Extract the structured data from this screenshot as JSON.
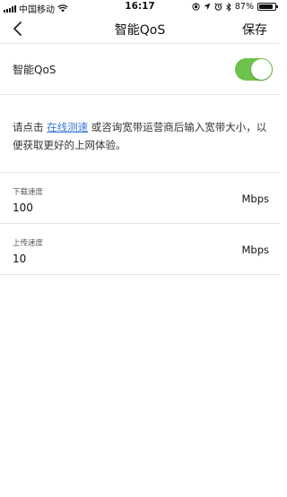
{
  "status_bar": {
    "carrier": "中国移动",
    "time": "16:17",
    "battery_percent": "87%",
    "battery_level": 0.87,
    "icons": [
      "signal-icon",
      "wifi-icon",
      "orientation-lock-icon",
      "location-icon",
      "alarm-icon",
      "bluetooth-icon",
      "battery-icon"
    ]
  },
  "nav": {
    "back_icon": "chevron-left-icon",
    "title": "智能QoS",
    "save_label": "保存"
  },
  "qos": {
    "label": "智能QoS",
    "enabled": true,
    "toggle_color": "#6cc24a"
  },
  "description": {
    "prefix": "请点击 ",
    "link_text": "在线测速",
    "suffix": " 或咨询宽带运营商后输入宽带大小，以便获取更好的上网体验。",
    "link_color": "#3a7bd5"
  },
  "download": {
    "label": "下载速度",
    "value": "100",
    "unit": "Mbps"
  },
  "upload": {
    "label": "上传速度",
    "value": "10",
    "unit": "Mbps"
  }
}
